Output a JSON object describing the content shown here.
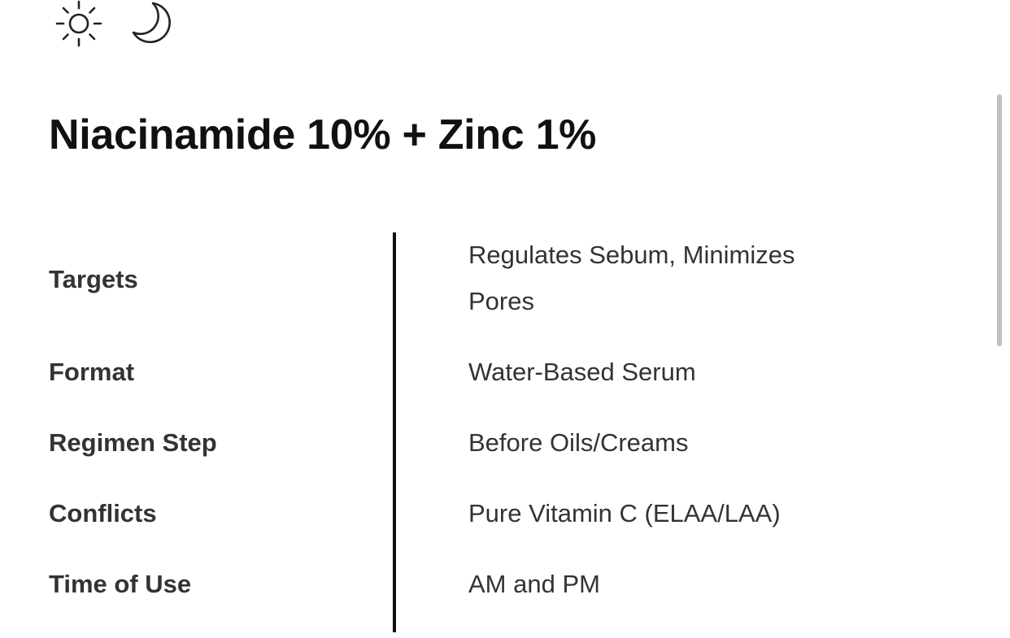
{
  "header": {
    "icons": [
      "sun-icon",
      "moon-icon"
    ]
  },
  "product": {
    "title": "Niacinamide 10% + Zinc 1%"
  },
  "details": [
    {
      "label": "Targets",
      "value_lines": [
        "Regulates Sebum, Minimizes",
        "Pores"
      ]
    },
    {
      "label": "Format",
      "value_lines": [
        "Water-Based Serum"
      ]
    },
    {
      "label": "Regimen Step",
      "value_lines": [
        "Before Oils/Creams"
      ]
    },
    {
      "label": "Conflicts",
      "value_lines": [
        "Pure Vitamin C (ELAA/LAA)"
      ]
    },
    {
      "label": "Time of Use",
      "value_lines": [
        "AM and PM"
      ]
    }
  ],
  "colors": {
    "text_dark": "#111111",
    "text_body": "#333333",
    "divider": "#111111",
    "scrollbar": "#bfbfbf"
  }
}
